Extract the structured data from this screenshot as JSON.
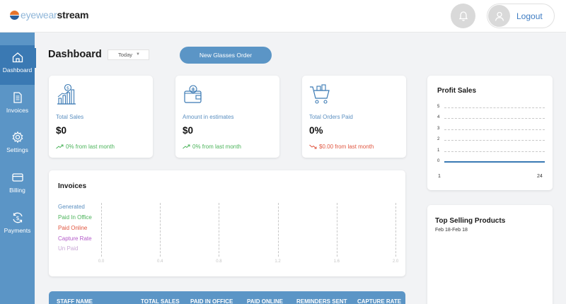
{
  "app": {
    "logo_light": "eyewear",
    "logo_bold": "stream",
    "logout_label": "Logout"
  },
  "sidebar": {
    "items": [
      {
        "label": "Dashboard",
        "icon": "home-icon",
        "active": true
      },
      {
        "label": "Invoices",
        "icon": "document-icon",
        "active": false
      },
      {
        "label": "Settings",
        "icon": "gear-icon",
        "active": false
      },
      {
        "label": "Billing",
        "icon": "credit-card-icon",
        "active": false
      },
      {
        "label": "Payments",
        "icon": "dollar-cycle-icon",
        "active": false
      }
    ]
  },
  "header": {
    "title": "Dashboard",
    "period": "Today",
    "new_order_label": "New Glasses Order"
  },
  "stats": [
    {
      "title": "Total Sales",
      "value": "$0",
      "delta": "0% from last month",
      "trend": "up",
      "icon": "sales-chart-icon"
    },
    {
      "title": "Amount in estimates",
      "value": "$0",
      "delta": "0% from last month",
      "trend": "up",
      "icon": "wallet-icon"
    },
    {
      "title": "Total Orders Paid",
      "value": "0%",
      "delta": "$0.00 from last month",
      "trend": "down",
      "icon": "shopping-cart-icon"
    }
  ],
  "invoices": {
    "title": "Invoices",
    "legend": [
      {
        "label": "Generated",
        "color": "#5b8fc0"
      },
      {
        "label": "Paid In Office",
        "color": "#4bb35a"
      },
      {
        "label": "Paid Online",
        "color": "#e0553f"
      },
      {
        "label": "Capture Rate",
        "color": "#b45bc9"
      },
      {
        "label": "Un Paid",
        "color": "#c9a9d6"
      }
    ],
    "ticks": [
      "0.0",
      "0.4",
      "0.8",
      "1.2",
      "1.6",
      "2.0"
    ]
  },
  "profit": {
    "title": "Profit Sales"
  },
  "chart_data": {
    "type": "line",
    "title": "Profit Sales",
    "x": [
      1,
      24
    ],
    "xticks": [
      "1",
      "24"
    ],
    "yticks": [
      "5",
      "4",
      "3",
      "2",
      "1",
      "0"
    ],
    "ylim": [
      0,
      5
    ],
    "series": [
      {
        "values": [
          0,
          0
        ]
      }
    ],
    "grid": true
  },
  "top_selling": {
    "title": "Top Selling Products",
    "range": "Feb 18-Feb 18"
  },
  "staff_table": {
    "columns": [
      "STAFF NAME",
      "TOTAL SALES",
      "PAID IN OFFICE",
      "PAID ONLINE",
      "REMINDERS SENT",
      "CAPTURE RATE"
    ]
  },
  "colors": {
    "accent": "#5b95c6",
    "accent_dark": "#3a79b3",
    "up": "#4bb35a",
    "down": "#e0553f"
  }
}
